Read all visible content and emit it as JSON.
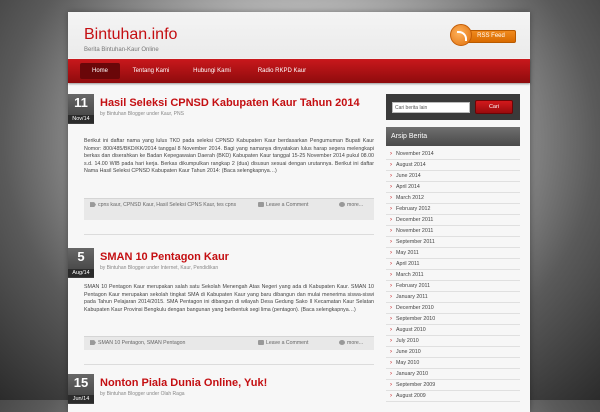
{
  "site": {
    "title": "Bintuhan.info",
    "description": "Berita Bintuhan-Kaur Online"
  },
  "rss": {
    "label": "RSS Feed"
  },
  "nav": [
    {
      "label": "Home",
      "active": true
    },
    {
      "label": "Tentang Kami",
      "active": false
    },
    {
      "label": "Hubungi Kami",
      "active": false
    },
    {
      "label": "Radio RKPD Kaur",
      "active": false
    }
  ],
  "posts": [
    {
      "day": "11",
      "month": "Nov/14",
      "title": "Hasil Seleksi CPNSD Kabupaten Kaur Tahun 2014",
      "meta": "by Bintuhan Blogger under Kaur, PNS",
      "excerpt": "Berikut ini daftar nama yang lulus TKD pada seleksi CPNSD Kabupaten Kaur berdasarkan Pengumuman Bupati Kaur Nomor: 800/485/BKD/KK/2014 tanggal 8 November 2014. Bagi yang namanya dinyatakan lulus harap segera melengkapi berkas dan diserahkan ke Badan Kepegawaian Daerah (BKD) Kabupaten Kaur tanggal 15-25 November 2014 pukul 08.00 s.d. 14.00 WIB pada hari kerja. Berkas dikumpulkan rangkap 2 (dua) disusun sesuai dengan urutannya. Berikut ini daftar Nama Hasil Seleksi CPNSD Kabupaten Kaur Tahun 2014: (Baca selengkapnya…)",
      "tags": "cpns kaur, CPNSD Kaur, Hasil Seleksi CPNS Kaur, tes cpns",
      "comments": "Leave a Comment",
      "more": "more..."
    },
    {
      "day": "5",
      "month": "Aug/14",
      "title": "SMAN 10 Pentagon Kaur",
      "meta": "by Bintuhan Blogger under Internet, Kaur, Pendidikan",
      "excerpt": "SMAN 10 Pentagon Kaur merupakan salah satu Sekolah Menengah Atas Negeri yang ada di Kabupaten Kaur. SMAN 10 Pentagon Kaur merupakan sekolah tingkat SMA di Kabupaten Kaur yang baru dibangun dan mulai menerima siswa-siswi pada Tahun Pelajaran 2014/2015. SMA Pentagon ini dibangun di wilayah Desa Gedung Sako II Kecamatan Kaur Selatan Kabupaten Kaur Provinsi Bengkulu dengan bangunan yang berbentuk segi lima (pentagon). (Baca selengkapnya…)",
      "tags": "SMAN 10 Pentagon, SMAN Pentagon",
      "comments": "Leave a Comment",
      "more": "more..."
    },
    {
      "day": "15",
      "month": "Jun/14",
      "title": "Nonton Piala Dunia Online, Yuk!",
      "meta": "by Bintuhan Blogger under Olah Raga"
    }
  ],
  "search": {
    "placeholder": "Cari berita lain",
    "button": "Cari"
  },
  "archive": {
    "heading": "Arsip Berita",
    "items": [
      "November 2014",
      "August 2014",
      "June 2014",
      "April 2014",
      "March 2012",
      "February 2012",
      "December 2011",
      "November 2011",
      "September 2011",
      "May 2011",
      "April 2011",
      "March 2011",
      "February 2011",
      "January 2011",
      "December 2010",
      "September 2010",
      "August 2010",
      "July 2010",
      "June 2010",
      "May 2010",
      "January 2010",
      "September 2009",
      "August 2009"
    ]
  }
}
